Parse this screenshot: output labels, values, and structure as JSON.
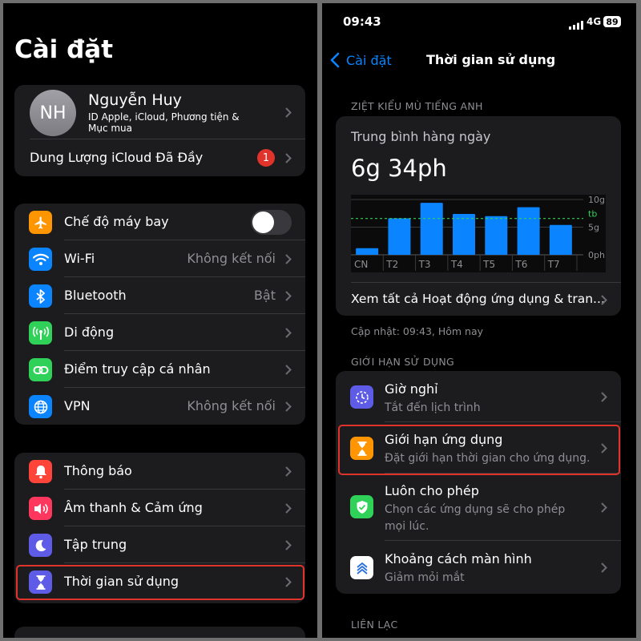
{
  "left": {
    "title": "Cài đặt",
    "profile": {
      "initials": "NH",
      "name": "Nguyễn Huy",
      "subtitle": "ID Apple, iCloud, Phương tiện & Mục mua"
    },
    "icloud_full": {
      "label": "Dung Lượng iCloud Đã Đầy",
      "badge": "1"
    },
    "connectivity": [
      {
        "label": "Chế độ máy bay",
        "icon": "airplane-icon",
        "color": "#ff9500",
        "toggle": false
      },
      {
        "label": "Wi-Fi",
        "value": "Không kết nối",
        "icon": "wifi-icon",
        "color": "#0a84ff"
      },
      {
        "label": "Bluetooth",
        "value": "Bật",
        "icon": "bluetooth-icon",
        "color": "#0a84ff"
      },
      {
        "label": "Di động",
        "icon": "cellular-icon",
        "color": "#30d158"
      },
      {
        "label": "Điểm truy cập cá nhân",
        "icon": "hotspot-icon",
        "color": "#30d158"
      },
      {
        "label": "VPN",
        "value": "Không kết nối",
        "icon": "vpn-globe-icon",
        "color": "#0a84ff"
      }
    ],
    "notifications": [
      {
        "label": "Thông báo",
        "icon": "bell-icon",
        "color": "#ff453a"
      },
      {
        "label": "Âm thanh & Cảm ứng",
        "icon": "speaker-icon",
        "color": "#ff375f"
      },
      {
        "label": "Tập trung",
        "icon": "moon-icon",
        "color": "#5e5ce6"
      },
      {
        "label": "Thời gian sử dụng",
        "icon": "hourglass-icon",
        "color": "#5e5ce6"
      }
    ],
    "highlight_color": "#e0332b"
  },
  "right": {
    "status": {
      "time": "09:43",
      "network": "4G",
      "battery": "89"
    },
    "nav": {
      "back": "Cài đặt",
      "title": "Thời gian sử dụng"
    },
    "section_user": "ZIỆT KIỂU MÙ TIẾNG ANH",
    "chart_card": {
      "caption": "Trung bình hàng ngày",
      "average": "6g 34ph",
      "see_all": "Xem tất cả Hoạt động ứng dụng & tran..."
    },
    "updated": "Cập nhật: 09:43, Hôm nay",
    "section_limits": "GIỚI HẠN SỬ DỤNG",
    "limits": [
      {
        "title": "Giờ nghỉ",
        "subtitle": "Tắt đến lịch trình",
        "icon": "downtime-icon",
        "color": "#5e5ce6"
      },
      {
        "title": "Giới hạn ứng dụng",
        "subtitle": "Đặt giới hạn thời gian cho ứng dụng.",
        "icon": "hourglass-icon",
        "color": "#ff9500"
      },
      {
        "title": "Luôn cho phép",
        "subtitle": "Chọn các ứng dụng sẽ cho phép mọi lúc.",
        "icon": "checkmark-shield-icon",
        "color": "#30d158"
      },
      {
        "title": "Khoảng cách màn hình",
        "subtitle": "Giảm mỏi mắt",
        "icon": "chevrons-up-icon",
        "color": "#ffffff"
      }
    ],
    "section_comm": "LIÊN LẠC"
  },
  "chart_data": {
    "type": "bar",
    "categories": [
      "CN",
      "T2",
      "T3",
      "T4",
      "T5",
      "T6",
      "T7"
    ],
    "values": [
      1.2,
      6.6,
      9.4,
      7.4,
      7.0,
      8.6,
      5.4
    ],
    "unit": "hours",
    "ylim": [
      0,
      10
    ],
    "y_ticks": [
      "10g",
      "5g",
      "0ph"
    ],
    "average_label": "tb",
    "average": 6.57,
    "bar_color": "#0a84ff",
    "average_color": "#30d158"
  }
}
